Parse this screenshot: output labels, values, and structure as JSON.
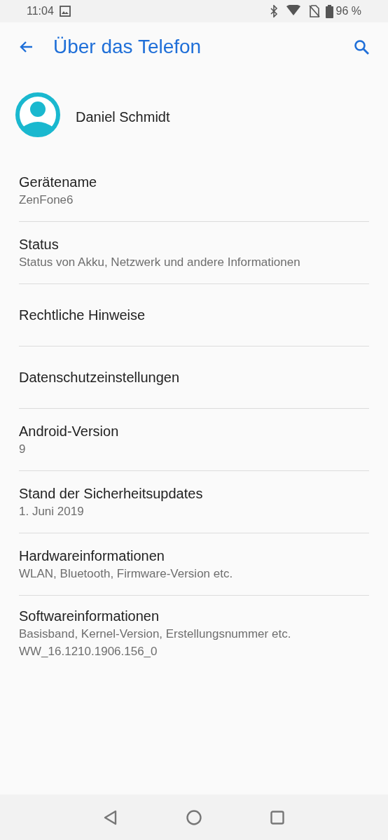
{
  "status_bar": {
    "time": "11:04",
    "battery": "96 %"
  },
  "toolbar": {
    "title": "Über das Telefon"
  },
  "profile": {
    "name": "Daniel Schmidt"
  },
  "items": [
    {
      "title": "Gerätename",
      "subtitles": [
        "ZenFone6"
      ]
    },
    {
      "title": "Status",
      "subtitles": [
        "Status von Akku, Netzwerk und andere Informationen"
      ]
    },
    {
      "title": "Rechtliche Hinweise"
    },
    {
      "title": "Datenschutzeinstellungen"
    },
    {
      "title": "Android-Version",
      "subtitles": [
        "9"
      ]
    },
    {
      "title": "Stand der Sicherheitsupdates",
      "subtitles": [
        "1. Juni 2019"
      ]
    },
    {
      "title": "Hardwareinformationen",
      "subtitles": [
        "WLAN, Bluetooth, Firmware-Version etc."
      ]
    },
    {
      "title": "Softwareinformationen",
      "subtitles": [
        "Basisband, Kernel-Version, Erstellungsnummer etc.",
        "WW_16.1210.1906.156_0"
      ]
    }
  ]
}
